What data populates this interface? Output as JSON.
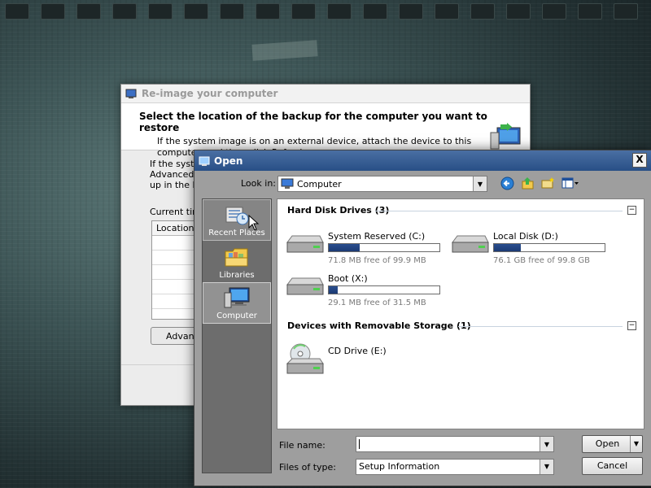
{
  "back_dialog": {
    "title": "Re-image your computer",
    "heading": "Select the location of the backup for the computer you want to restore",
    "subtext": "If the system image is on an external device, attach the device to this computer, and then click Refresh.",
    "body_lines": [
      "If the syste",
      "Advanced t",
      "up in the lis"
    ],
    "current_label": "Current tim",
    "table_header": "Location",
    "advanced_button": "Advanc"
  },
  "open_dialog": {
    "title": "Open",
    "close_glyph": "X",
    "look_in_label": "Look in:",
    "look_in_value": "Computer",
    "places": [
      {
        "label": "Recent Places",
        "icon": "recent-places-icon",
        "state": "hover"
      },
      {
        "label": "Libraries",
        "icon": "libraries-icon",
        "state": "normal"
      },
      {
        "label": "Computer",
        "icon": "computer-icon",
        "state": "selected"
      }
    ],
    "groups": {
      "hdd_header": "Hard Disk Drives (3)",
      "removable_header": "Devices with Removable Storage (1)"
    },
    "drives": [
      {
        "name": "System Reserved (C:)",
        "free": "71.8 MB free of 99.9 MB",
        "used_fraction": 0.28
      },
      {
        "name": "Local Disk (D:)",
        "free": "76.1 GB free of 99.8 GB",
        "used_fraction": 0.24
      },
      {
        "name": "Boot (X:)",
        "free": "29.1 MB free of 31.5 MB",
        "used_fraction": 0.08
      }
    ],
    "cd_drive": "CD Drive (E:)",
    "file_name_label": "File name:",
    "file_name_value": "",
    "files_of_type_label": "Files of type:",
    "files_of_type_value": "Setup Information",
    "open_button": "Open",
    "cancel_button": "Cancel"
  },
  "colors": {
    "title_bar": "#284f86",
    "bar_fill": "#1c3a73",
    "places_bg": "#6d6d6d"
  }
}
